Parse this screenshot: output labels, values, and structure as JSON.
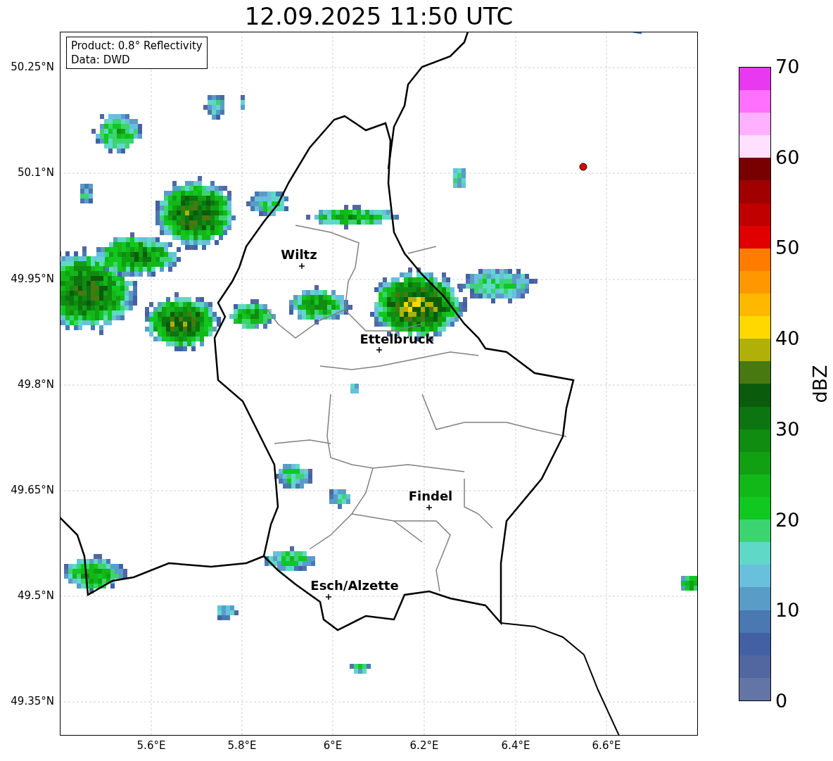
{
  "title": "12.09.2025 11:50 UTC",
  "info_box": {
    "lines": [
      "Product: 0.8° Reflectivity",
      "Data: DWD"
    ]
  },
  "map": {
    "cities": [
      {
        "name": "Wiltz"
      },
      {
        "name": "Ettelbruck"
      },
      {
        "name": "Findel"
      },
      {
        "name": "Esch/Alzette"
      }
    ]
  },
  "x_ticks": [
    "5.6°E",
    "5.8°E",
    "6°E",
    "6.2°E",
    "6.4°E",
    "6.6°E"
  ],
  "y_ticks": [
    "50.25°N",
    "50.1°N",
    "49.95°N",
    "49.8°N",
    "49.65°N",
    "49.5°N",
    "49.35°N"
  ],
  "colorbar": {
    "label": "dBZ",
    "ticks": [
      "70",
      "60",
      "50",
      "40",
      "30",
      "20",
      "10",
      "0"
    ],
    "bands": [
      {
        "color": "#6374a6"
      },
      {
        "color": "#5266a0"
      },
      {
        "color": "#4460a4"
      },
      {
        "color": "#4a78b0"
      },
      {
        "color": "#5a9cc8"
      },
      {
        "color": "#68c0dc"
      },
      {
        "color": "#60d8c8"
      },
      {
        "color": "#3cd470"
      },
      {
        "color": "#10c820"
      },
      {
        "color": "#12b818"
      },
      {
        "color": "#10a012"
      },
      {
        "color": "#108c10"
      },
      {
        "color": "#0c7410"
      },
      {
        "color": "#0a5c0c"
      },
      {
        "color": "#487810"
      },
      {
        "color": "#b0b008"
      },
      {
        "color": "#ffd800"
      },
      {
        "color": "#ffb800"
      },
      {
        "color": "#ff9800"
      },
      {
        "color": "#ff7c00"
      },
      {
        "color": "#e00000"
      },
      {
        "color": "#c00000"
      },
      {
        "color": "#a00000"
      },
      {
        "color": "#780000"
      },
      {
        "color": "#ffe0ff"
      },
      {
        "color": "#ffb0ff"
      },
      {
        "color": "#ff70ff"
      },
      {
        "color": "#e838f0"
      }
    ]
  }
}
